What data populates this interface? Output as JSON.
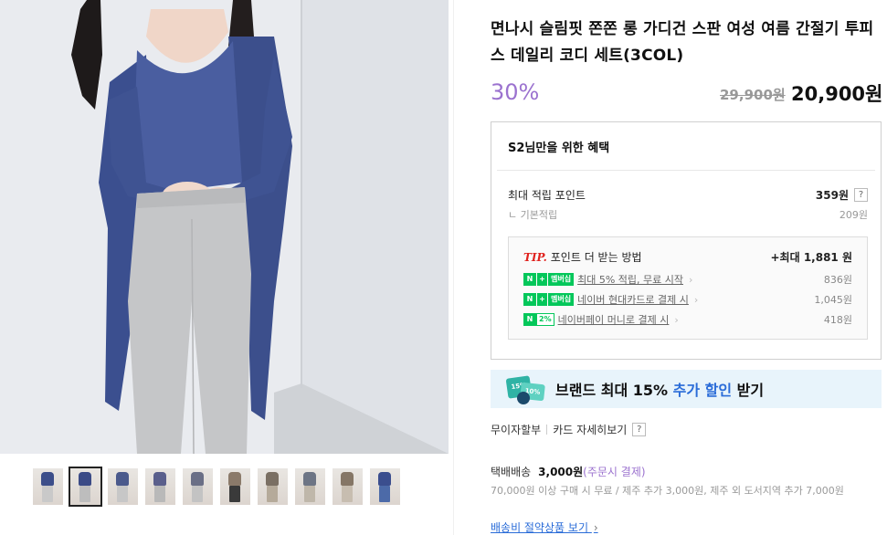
{
  "product": {
    "title": "면나시 슬림핏 쫀쫀 롱 가디건 스판 여성 여름 간절기 투피스 데일리 코디 세트(3COL)",
    "discount_rate": "30%",
    "original_price": "29,900원",
    "sale_price": "20,900원"
  },
  "gallery": {
    "main_image_alt": "model wearing navy long cardigan set with gray slacks",
    "thumbnail_count": 10,
    "selected_index": 1,
    "thumbnail_colors": [
      [
        "#3c4e8a",
        "#c9c9c9"
      ],
      [
        "#3a4a86",
        "#bdbdbd"
      ],
      [
        "#4b5a8c",
        "#c7c7c7"
      ],
      [
        "#5a5f8c",
        "#b9b9b9"
      ],
      [
        "#6a6f86",
        "#c3c3c3"
      ],
      [
        "#8b7a6a",
        "#3a3a3a"
      ],
      [
        "#7a6f63",
        "#b5aa9a"
      ],
      [
        "#6d7585",
        "#bfb7aa"
      ],
      [
        "#857666",
        "#c7bdb0"
      ],
      [
        "#3b4e8e",
        "#4c6aa8"
      ]
    ]
  },
  "benefit": {
    "title": "S2님만을 위한 혜택",
    "max_points_label": "최대 적립 포인트",
    "max_points_value": "359원",
    "help_icon": "?",
    "base_label": "기본적립",
    "base_value": "209원",
    "tip": {
      "mark": "TIP.",
      "heading": "포인트 더 받는 방법",
      "max_label": "+최대 1,881 원",
      "rows": [
        {
          "badge_pct": "+",
          "badge_text": "멤버십",
          "label": "최대 5% 적립, 무료 시작",
          "value": "836원"
        },
        {
          "badge_pct": "+",
          "badge_text": "멤버십",
          "label": "네이버 현대카드로 결제 시",
          "value": "1,045원"
        },
        {
          "badge_pct": "2%",
          "badge_text": "",
          "label": "네이버페이 머니로 결제 시",
          "value": "418원"
        }
      ],
      "badge_n": "N"
    }
  },
  "brand_banner": {
    "prefix": "브랜드 최대 15% ",
    "highlight": "추가 할인",
    "suffix": " 받기",
    "coupon_text_1": "15%",
    "coupon_text_2": "10%"
  },
  "card_links": {
    "installment": "무이자할부",
    "card_benefit": "카드 자세히보기",
    "help_icon": "?"
  },
  "shipping": {
    "label": "택배배송",
    "fee": "3,000원",
    "note": "(주문시 결제)",
    "description": "70,000원 이상 구매 시 무료 / 제주 추가 3,000원, 제주 외 도서지역 추가 7,000원",
    "saving_link": "배송비 절약상품 보기"
  },
  "colors": {
    "discount": "#9b72cf",
    "npay_green": "#03c75a",
    "tip_red": "#e0221e",
    "link_blue": "#2a6cd8",
    "banner_bg": "#e8f4fb"
  }
}
